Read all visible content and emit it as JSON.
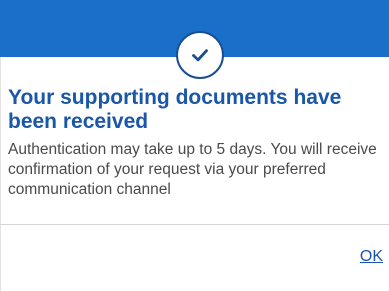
{
  "dialog": {
    "title": "Your supporting documents have been received",
    "message": "Authentication may take up to 5 days. You will receive confirmation of your request via your preferred communication channel",
    "ok_label": "OK",
    "status_icon": "checkmark-icon"
  },
  "colors": {
    "header": "#1a6fc9",
    "accent": "#1a57a8",
    "body_text": "#4a4a4a",
    "divider": "#d4d4d4"
  }
}
